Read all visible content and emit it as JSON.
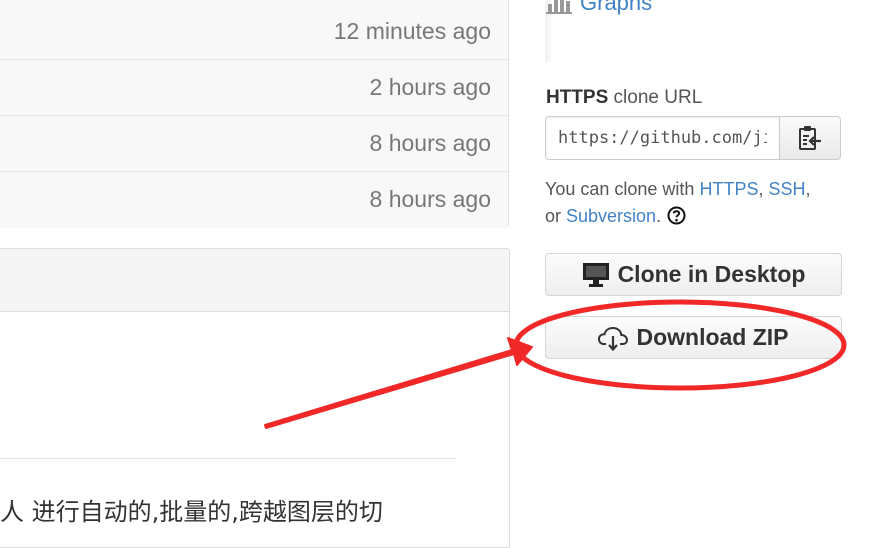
{
  "file_list": {
    "rows": [
      {
        "age": "12 minutes ago"
      },
      {
        "age": "2 hours ago"
      },
      {
        "age": "8 hours ago"
      },
      {
        "age": "8 hours ago"
      }
    ]
  },
  "readme": {
    "text": "人 进行自动的,批量的,跨越图层的切"
  },
  "sidebar": {
    "graphs_label": "Graphs",
    "graphs_icon": "bar-chart-icon",
    "clone": {
      "title_bold": "HTTPS",
      "title_rest": " clone URL",
      "url_value": "https://github.com/ji",
      "copy_icon": "clipboard-icon",
      "help_prefix": "You can clone with ",
      "help_https": "HTTPS",
      "help_sep1": ", ",
      "help_ssh": "SSH",
      "help_sep2": ",",
      "help_or": "or ",
      "help_subversion": "Subversion",
      "help_dot": ".",
      "help_icon": "question-icon"
    },
    "clone_desktop_label": "Clone in Desktop",
    "clone_desktop_icon": "monitor-icon",
    "download_zip_label": "Download ZIP",
    "download_zip_icon": "cloud-download-icon"
  },
  "colors": {
    "link": "#4183c4",
    "annotation_red": "#f02828"
  }
}
